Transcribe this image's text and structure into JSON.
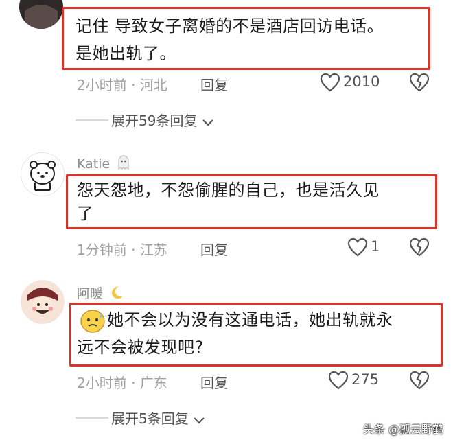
{
  "comments": [
    {
      "username": "",
      "text_lines": [
        "记住 导致女子离婚的不是酒店回访电话。",
        "是她出轨了。"
      ],
      "time": "2小时前",
      "location": "河北",
      "reply_label": "回复",
      "likes": "2010",
      "expand_label": "展开59条回复"
    },
    {
      "username": "Katie",
      "text_lines": [
        "怨天怨地，不怨偷腥的自己，也是活久见",
        "了"
      ],
      "time": "1分钟前",
      "location": "江苏",
      "reply_label": "回复",
      "likes": "1",
      "expand_label": ""
    },
    {
      "username": "阿暖",
      "text_lines": [
        "她不会以为没有这通电话，她出轨就永",
        "远不会被发现吧?"
      ],
      "time": "2小时前",
      "location": "广东",
      "reply_label": "回复",
      "likes": "275",
      "expand_label": "展开5条回复"
    }
  ],
  "meta_separator": "·",
  "watermark": "头条 @孤云野鹤",
  "colors": {
    "highlight_border": "#d6352b",
    "meta_text": "#a0a0a0"
  },
  "icons": [
    "heart-icon",
    "broken-heart-icon",
    "chevron-down-icon",
    "ghost-emoji-icon",
    "moon-emoji-icon",
    "sweat-emoji-icon"
  ]
}
